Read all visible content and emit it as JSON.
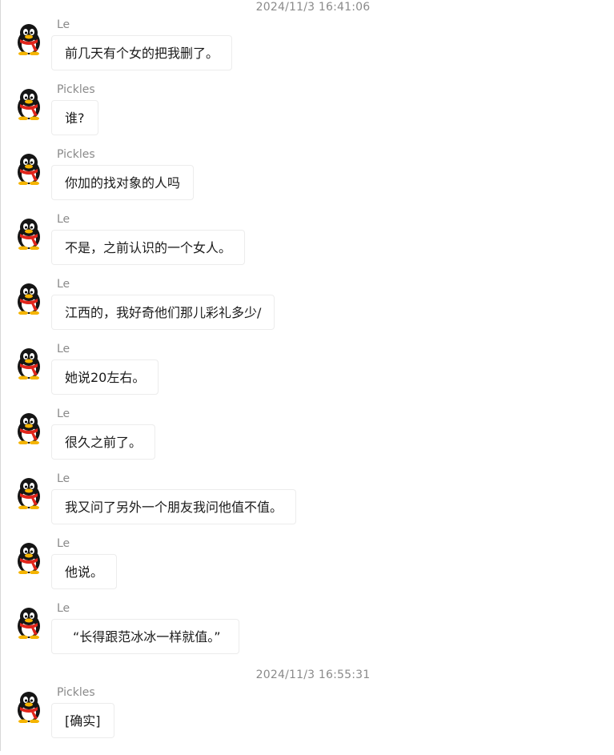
{
  "chat": {
    "timestamps": [
      "2024/11/3 16:41:06",
      "2024/11/3 16:55:31"
    ],
    "messages": [
      {
        "sender": "Le",
        "text": "前几天有个女的把我删了。",
        "avatar": "penguin-icon"
      },
      {
        "sender": "Pickles",
        "text": "谁?",
        "avatar": "penguin-icon"
      },
      {
        "sender": "Pickles",
        "text": "你加的找对象的人吗",
        "avatar": "penguin-icon"
      },
      {
        "sender": "Le",
        "text": "不是，之前认识的一个女人。",
        "avatar": "penguin-icon"
      },
      {
        "sender": "Le",
        "text": "江西的，我好奇他们那儿彩礼多少/",
        "avatar": "penguin-icon"
      },
      {
        "sender": "Le",
        "text": "她说20左右。",
        "avatar": "penguin-icon"
      },
      {
        "sender": "Le",
        "text": "很久之前了。",
        "avatar": "penguin-icon"
      },
      {
        "sender": "Le",
        "text": "我又问了另外一个朋友我问他值不值。",
        "avatar": "penguin-icon"
      },
      {
        "sender": "Le",
        "text": "他说。",
        "avatar": "penguin-icon"
      },
      {
        "sender": "Le",
        "text": "“长得跟范冰冰一样就值。”",
        "avatar": "penguin-icon"
      },
      {
        "sender": "Pickles",
        "text": "[确实]",
        "avatar": "penguin-icon"
      }
    ]
  }
}
